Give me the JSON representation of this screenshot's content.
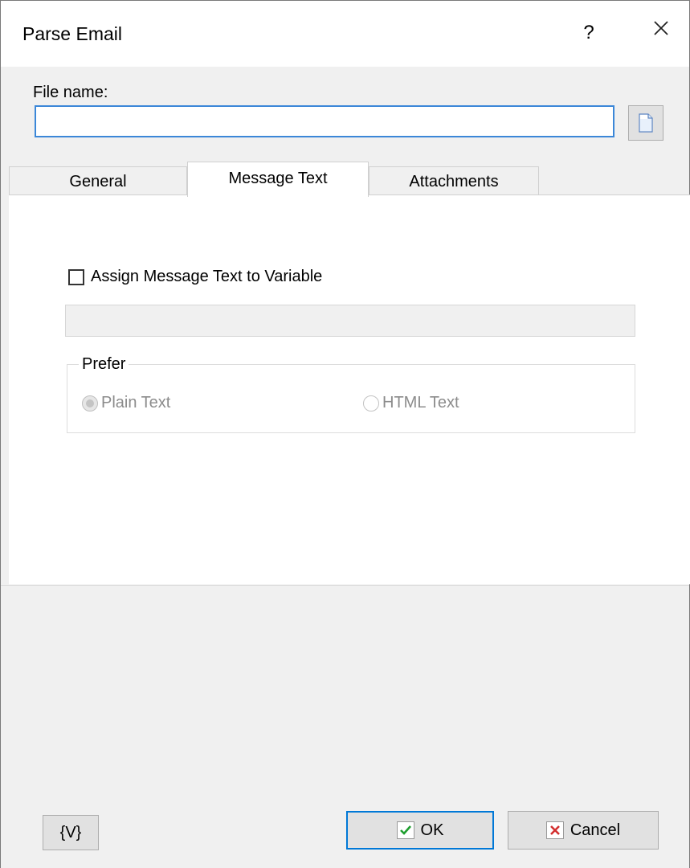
{
  "window": {
    "title": "Parse Email",
    "help_label": "?",
    "close_label": "✕"
  },
  "file": {
    "label": "File name:",
    "value": "",
    "browse_icon": "document-icon"
  },
  "tabs": [
    {
      "label": "General",
      "active": false
    },
    {
      "label": "Message Text",
      "active": true
    },
    {
      "label": "Attachments",
      "active": false
    }
  ],
  "message_text": {
    "assign_label": "Assign Message Text to Variable",
    "assign_checked": false,
    "variable_value": "",
    "prefer": {
      "legend": "Prefer",
      "options": [
        {
          "label": "Plain Text",
          "selected": true
        },
        {
          "label": "HTML Text",
          "selected": false
        }
      ]
    }
  },
  "footer": {
    "variables_label": "{V}",
    "ok_label": "OK",
    "cancel_label": "Cancel"
  },
  "colors": {
    "accent": "#0078d7",
    "ok_check": "#1e9e2e",
    "cancel_x": "#d32f2f"
  }
}
